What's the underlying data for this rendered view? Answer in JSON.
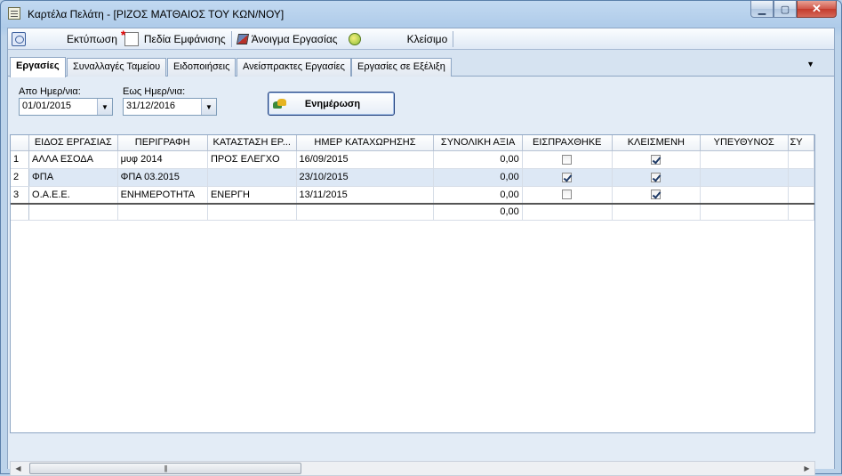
{
  "window": {
    "title": "Καρτέλα Πελάτη - [ΡΙΖΟΣ ΜΑΤΘΑΙΟΣ ΤΟΥ ΚΩΝ/ΝΟΥ]"
  },
  "toolbar": {
    "print_label": "Εκτύπωση",
    "fields_label": "Πεδία Εμφάνισης",
    "open_label": "Άνοιγμα Εργασίας",
    "close_label": "Κλείσιμο"
  },
  "tabs": [
    {
      "label": "Εργασίες",
      "active": true
    },
    {
      "label": "Συναλλαγές Ταμείου"
    },
    {
      "label": "Ειδοποιήσεις"
    },
    {
      "label": "Ανείσπρακτες Εργασίες"
    },
    {
      "label": "Εργασίες σε Εξέλιξη"
    }
  ],
  "filters": {
    "from_label": "Απο Ημερ/νια:",
    "from_value": "01/01/2015",
    "to_label": "Εως Ημερ/νια:",
    "to_value": "31/12/2016",
    "refresh_label": "Ενημέρωση"
  },
  "grid": {
    "columns": [
      "ΕΙΔΟΣ ΕΡΓΑΣΙΑΣ",
      "ΠΕΡΙΓΡΑΦΗ",
      "ΚΑΤΑΣΤΑΣΗ ΕΡ...",
      "ΗΜΕΡ ΚΑΤΑΧΩΡΗΣΗΣ",
      "ΣΥΝΟΛΙΚΗ ΑΞΙΑ",
      "ΕΙΣΠΡΑΧΘΗΚΕ",
      "ΚΛΕΙΣΜΕΝΗ",
      "ΥΠΕΥΘΥΝΟΣ",
      "ΣΥ"
    ],
    "rows": [
      {
        "num": "1",
        "type": "ΑΛΛΑ ΕΣΟΔΑ",
        "desc": "μυφ 2014",
        "status": "ΠΡΟΣ ΕΛΕΓΧΟ",
        "date": "16/09/2015",
        "total": "0,00",
        "collected": false,
        "closed": true
      },
      {
        "num": "2",
        "type": "ΦΠΑ",
        "desc": "ΦΠΑ 03.2015",
        "status": "",
        "date": "23/10/2015",
        "total": "0,00",
        "collected": true,
        "closed": true
      },
      {
        "num": "3",
        "type": "Ο.Α.Ε.Ε.",
        "desc": "ΕΝΗΜΕΡΟΤΗΤΑ",
        "status": "ΕΝΕΡΓΗ",
        "date": "13/11/2015",
        "total": "0,00",
        "collected": false,
        "closed": true
      }
    ],
    "sum_total": "0,00"
  }
}
